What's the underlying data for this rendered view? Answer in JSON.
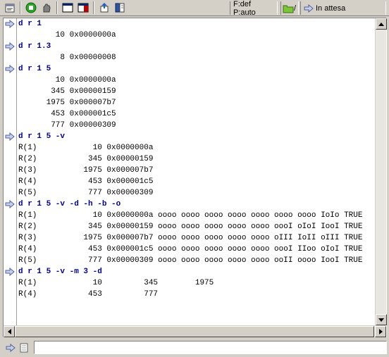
{
  "toolbar": {
    "icons": [
      "properties-icon",
      "run-icon",
      "stop-icon",
      "window-icon",
      "window-split-icon",
      "export-icon",
      "book-icon"
    ],
    "status_field": "F:def P:auto",
    "folder_path": "/",
    "state_label": "In attesa"
  },
  "console": {
    "lines": [
      {
        "type": "cmd",
        "text": "d r 1"
      },
      {
        "type": "out",
        "text": "        10 0x0000000a"
      },
      {
        "type": "cmd",
        "text": "d r 1.3"
      },
      {
        "type": "out",
        "text": "         8 0x00000008"
      },
      {
        "type": "cmd",
        "text": "d r 1 5"
      },
      {
        "type": "out",
        "text": "        10 0x0000000a"
      },
      {
        "type": "out",
        "text": "       345 0x00000159"
      },
      {
        "type": "out",
        "text": "      1975 0x000007b7"
      },
      {
        "type": "out",
        "text": "       453 0x000001c5"
      },
      {
        "type": "out",
        "text": "       777 0x00000309"
      },
      {
        "type": "cmd",
        "text": "d r 1 5 -v"
      },
      {
        "type": "out",
        "text": "R(1)            10 0x0000000a"
      },
      {
        "type": "out",
        "text": "R(2)           345 0x00000159"
      },
      {
        "type": "out",
        "text": "R(3)          1975 0x000007b7"
      },
      {
        "type": "out",
        "text": "R(4)           453 0x000001c5"
      },
      {
        "type": "out",
        "text": "R(5)           777 0x00000309"
      },
      {
        "type": "cmd",
        "text": "d r 1 5 -v -d -h -b -o"
      },
      {
        "type": "out",
        "text": "R(1)            10 0x0000000a oooo oooo oooo oooo oooo oooo oooo IoIo TRUE"
      },
      {
        "type": "out",
        "text": "R(2)           345 0x00000159 oooo oooo oooo oooo oooo oooI oIoI IooI TRUE"
      },
      {
        "type": "out",
        "text": "R(3)          1975 0x000007b7 oooo oooo oooo oooo oooo oIII IoII oIII TRUE"
      },
      {
        "type": "out",
        "text": "R(4)           453 0x000001c5 oooo oooo oooo oooo oooo oooI IIoo oIoI TRUE"
      },
      {
        "type": "out",
        "text": "R(5)           777 0x00000309 oooo oooo oooo oooo oooo ooII oooo IooI TRUE"
      },
      {
        "type": "cmd",
        "text": "d r 1 5 -v -m 3 -d"
      },
      {
        "type": "out",
        "text": "R(1)            10         345        1975"
      },
      {
        "type": "out",
        "text": "R(4)           453         777"
      }
    ]
  },
  "input": {
    "value": "",
    "placeholder": ""
  }
}
